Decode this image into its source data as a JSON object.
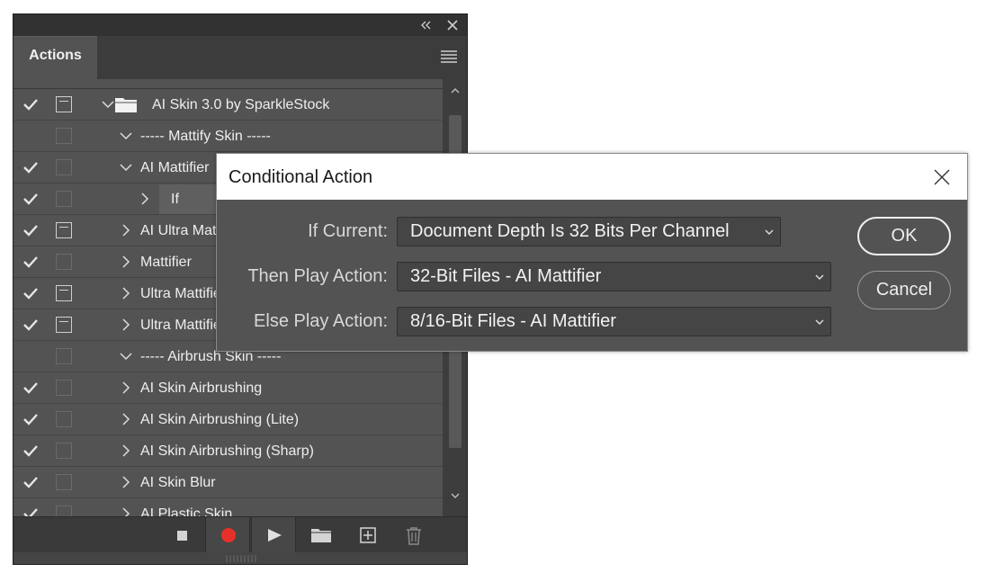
{
  "panel": {
    "tab_label": "Actions",
    "rows": [
      {
        "checked": true,
        "dialog": true,
        "indent": 0,
        "expanded": true,
        "folder": true,
        "label": "AI Skin 3.0 by SparkleStock"
      },
      {
        "checked": false,
        "dialog": false,
        "indent": 1,
        "expanded": true,
        "folder": false,
        "label": "----- Mattify Skin -----"
      },
      {
        "checked": true,
        "dialog": false,
        "indent": 1,
        "expanded": true,
        "folder": false,
        "label": "AI Mattifier"
      },
      {
        "checked": true,
        "dialog": false,
        "indent": 2,
        "expanded": false,
        "folder": false,
        "label": "If",
        "selected": true
      },
      {
        "checked": true,
        "dialog": true,
        "indent": 1,
        "expanded": false,
        "folder": false,
        "label": "AI Ultra Mattifier"
      },
      {
        "checked": true,
        "dialog": false,
        "indent": 1,
        "expanded": false,
        "folder": false,
        "label": "Mattifier"
      },
      {
        "checked": true,
        "dialog": true,
        "indent": 1,
        "expanded": false,
        "folder": false,
        "label": "Ultra Mattifier"
      },
      {
        "checked": true,
        "dialog": true,
        "indent": 1,
        "expanded": false,
        "folder": false,
        "label": "Ultra Mattifier"
      },
      {
        "checked": false,
        "dialog": false,
        "indent": 1,
        "expanded": true,
        "folder": false,
        "label": "----- Airbrush Skin -----"
      },
      {
        "checked": true,
        "dialog": false,
        "indent": 1,
        "expanded": false,
        "folder": false,
        "label": "AI Skin Airbrushing"
      },
      {
        "checked": true,
        "dialog": false,
        "indent": 1,
        "expanded": false,
        "folder": false,
        "label": "AI Skin Airbrushing (Lite)"
      },
      {
        "checked": true,
        "dialog": false,
        "indent": 1,
        "expanded": false,
        "folder": false,
        "label": "AI Skin Airbrushing (Sharp)"
      },
      {
        "checked": true,
        "dialog": false,
        "indent": 1,
        "expanded": false,
        "folder": false,
        "label": "AI Skin Blur"
      },
      {
        "checked": true,
        "dialog": false,
        "indent": 1,
        "expanded": false,
        "folder": false,
        "label": "AI Plastic Skin"
      }
    ],
    "icons": {
      "collapse": "double-chevron-left-icon",
      "close": "close-icon",
      "menu": "hamburger-menu-icon",
      "stop": "stop-icon",
      "record": "record-icon",
      "play": "play-icon",
      "new_set": "folder-icon",
      "new_action": "new-action-icon",
      "delete": "trash-icon"
    },
    "record_color": "#e8302a"
  },
  "dialog": {
    "title": "Conditional Action",
    "if_label": "If Current:",
    "if_value": "Document Depth Is 32 Bits Per Channel",
    "then_label": "Then Play Action:",
    "then_value": "32-Bit Files - AI Mattifier",
    "else_label": "Else Play Action:",
    "else_value": "8/16-Bit Files - AI Mattifier",
    "ok_label": "OK",
    "cancel_label": "Cancel"
  }
}
